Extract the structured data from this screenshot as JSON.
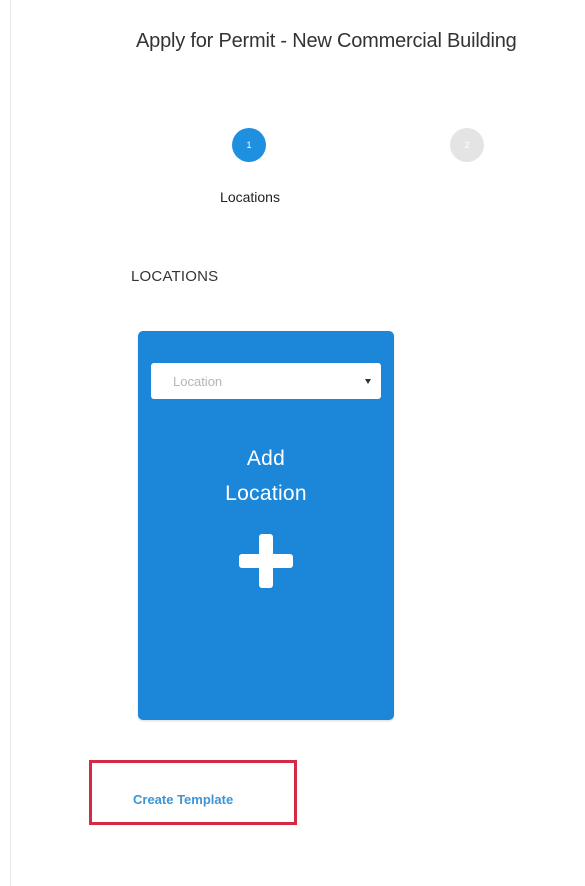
{
  "page": {
    "title": "Apply for Permit - New Commercial Building"
  },
  "stepper": {
    "steps": [
      {
        "number": "1",
        "label": "Locations",
        "state": "active"
      },
      {
        "number": "2",
        "label": "",
        "state": "inactive"
      }
    ]
  },
  "section": {
    "heading": "LOCATIONS"
  },
  "location_card": {
    "select_placeholder": "Location",
    "add_line_1": "Add",
    "add_line_2": "Location",
    "plus_icon": "plus-icon"
  },
  "actions": {
    "create_template_label": "Create Template"
  },
  "colors": {
    "accent": "#1c87d8",
    "step_active": "#1f8fe0",
    "step_inactive": "#e4e4e4",
    "link": "#3b95d6",
    "highlight_border": "#d42a43"
  }
}
